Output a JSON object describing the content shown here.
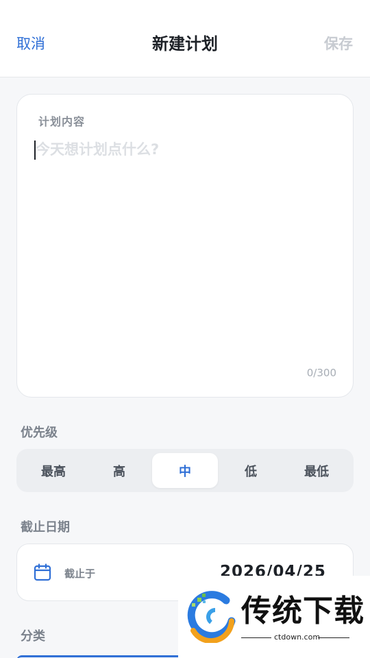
{
  "header": {
    "cancel_label": "取消",
    "title": "新建计划",
    "save_label": "保存"
  },
  "content": {
    "label": "计划内容",
    "placeholder": "今天想计划点什么?",
    "value": "",
    "counter": "0/300"
  },
  "priority": {
    "label": "优先级",
    "options": [
      "最高",
      "高",
      "中",
      "低",
      "最低"
    ],
    "selected": "中"
  },
  "deadline": {
    "label": "截止日期",
    "field_label": "截止于",
    "value": "2026/04/25",
    "icon": "calendar-icon"
  },
  "category": {
    "label": "分类"
  },
  "watermark": {
    "brand": "传统下载",
    "site": "ctdown.com"
  },
  "colors": {
    "accent": "#2f6fd6",
    "disabled": "#c7cbd1",
    "background": "#f6f7f9"
  }
}
